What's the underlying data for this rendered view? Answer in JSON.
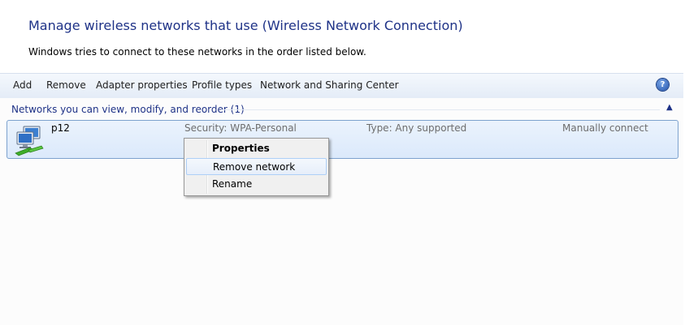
{
  "header": {
    "title": "Manage wireless networks that use (Wireless Network Connection)",
    "subtitle": "Windows tries to connect to these networks in the order listed below."
  },
  "toolbar": {
    "buttons": [
      "Add",
      "Remove",
      "Adapter properties",
      "Profile types",
      "Network and Sharing Center"
    ],
    "help_label": "?"
  },
  "group": {
    "header": "Networks you can view, modify, and reorder (1)",
    "collapse_glyph": "▲"
  },
  "networks": [
    {
      "name": "p12",
      "security": "Security:  WPA-Personal",
      "type": "Type:  Any supported",
      "mode": "Manually connect"
    }
  ],
  "context_menu": {
    "items": [
      "Properties",
      "Remove network",
      "Rename"
    ]
  },
  "icons": {
    "network": "wireless-network-icon",
    "help": "help-icon",
    "collapse": "chevron-up-icon"
  },
  "colors": {
    "title": "#1e3287",
    "selection_border": "#7da2ce",
    "selection_fill": "#dbe9fb"
  }
}
